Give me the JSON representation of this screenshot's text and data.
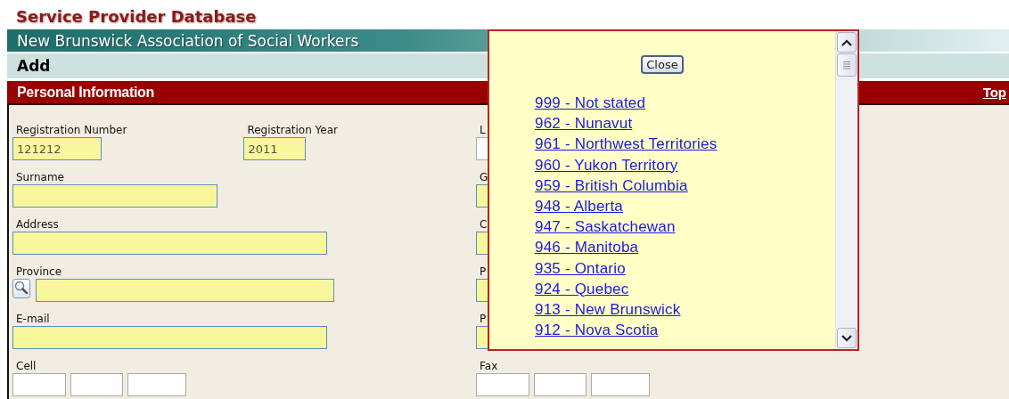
{
  "header": {
    "title": "Service Provider Database",
    "organization": "New Brunswick Association of Social Workers",
    "mode": "Add"
  },
  "section": {
    "title": "Personal Information",
    "top_link": "Top"
  },
  "rows": [
    {
      "left": [
        {
          "label": "Registration Number",
          "value": "121212",
          "kind": "text",
          "required": true
        },
        {
          "label": "Registration Year",
          "value": "2011",
          "kind": "text",
          "required": true
        }
      ],
      "right": [
        {
          "label": "L",
          "kind": "text",
          "required": false
        }
      ]
    },
    {
      "left": [
        {
          "label": "Surname",
          "kind": "text",
          "required": true
        }
      ],
      "right": [
        {
          "label": "G",
          "kind": "text",
          "required": true
        }
      ]
    },
    {
      "left": [
        {
          "label": "Address",
          "kind": "text",
          "required": true
        }
      ],
      "right": [
        {
          "label": "C",
          "kind": "text",
          "required": true
        }
      ]
    },
    {
      "left": [
        {
          "label": "Province",
          "kind": "lookup",
          "required": true
        }
      ],
      "right": [
        {
          "label": "P",
          "kind": "text",
          "required": true
        }
      ]
    },
    {
      "left": [
        {
          "label": "E-mail",
          "kind": "text",
          "required": true
        }
      ],
      "right": [
        {
          "label": "P",
          "kind": "text",
          "required": true
        }
      ]
    },
    {
      "left": [
        {
          "label": "Cell",
          "kind": "phone",
          "required": false
        }
      ],
      "right": [
        {
          "label": "Fax",
          "kind": "phone",
          "required": false
        }
      ]
    }
  ],
  "popup": {
    "close": "Close",
    "items": [
      "999 - Not stated",
      "962 - Nunavut",
      "961 - Northwest Territories",
      "960 - Yukon Territory",
      "959 - British Columbia",
      "948 - Alberta",
      "947 - Saskatchewan",
      "946 - Manitoba",
      "935 - Ontario",
      "924 - Quebec",
      "913 - New Brunswick",
      "912 - Nova Scotia"
    ]
  }
}
